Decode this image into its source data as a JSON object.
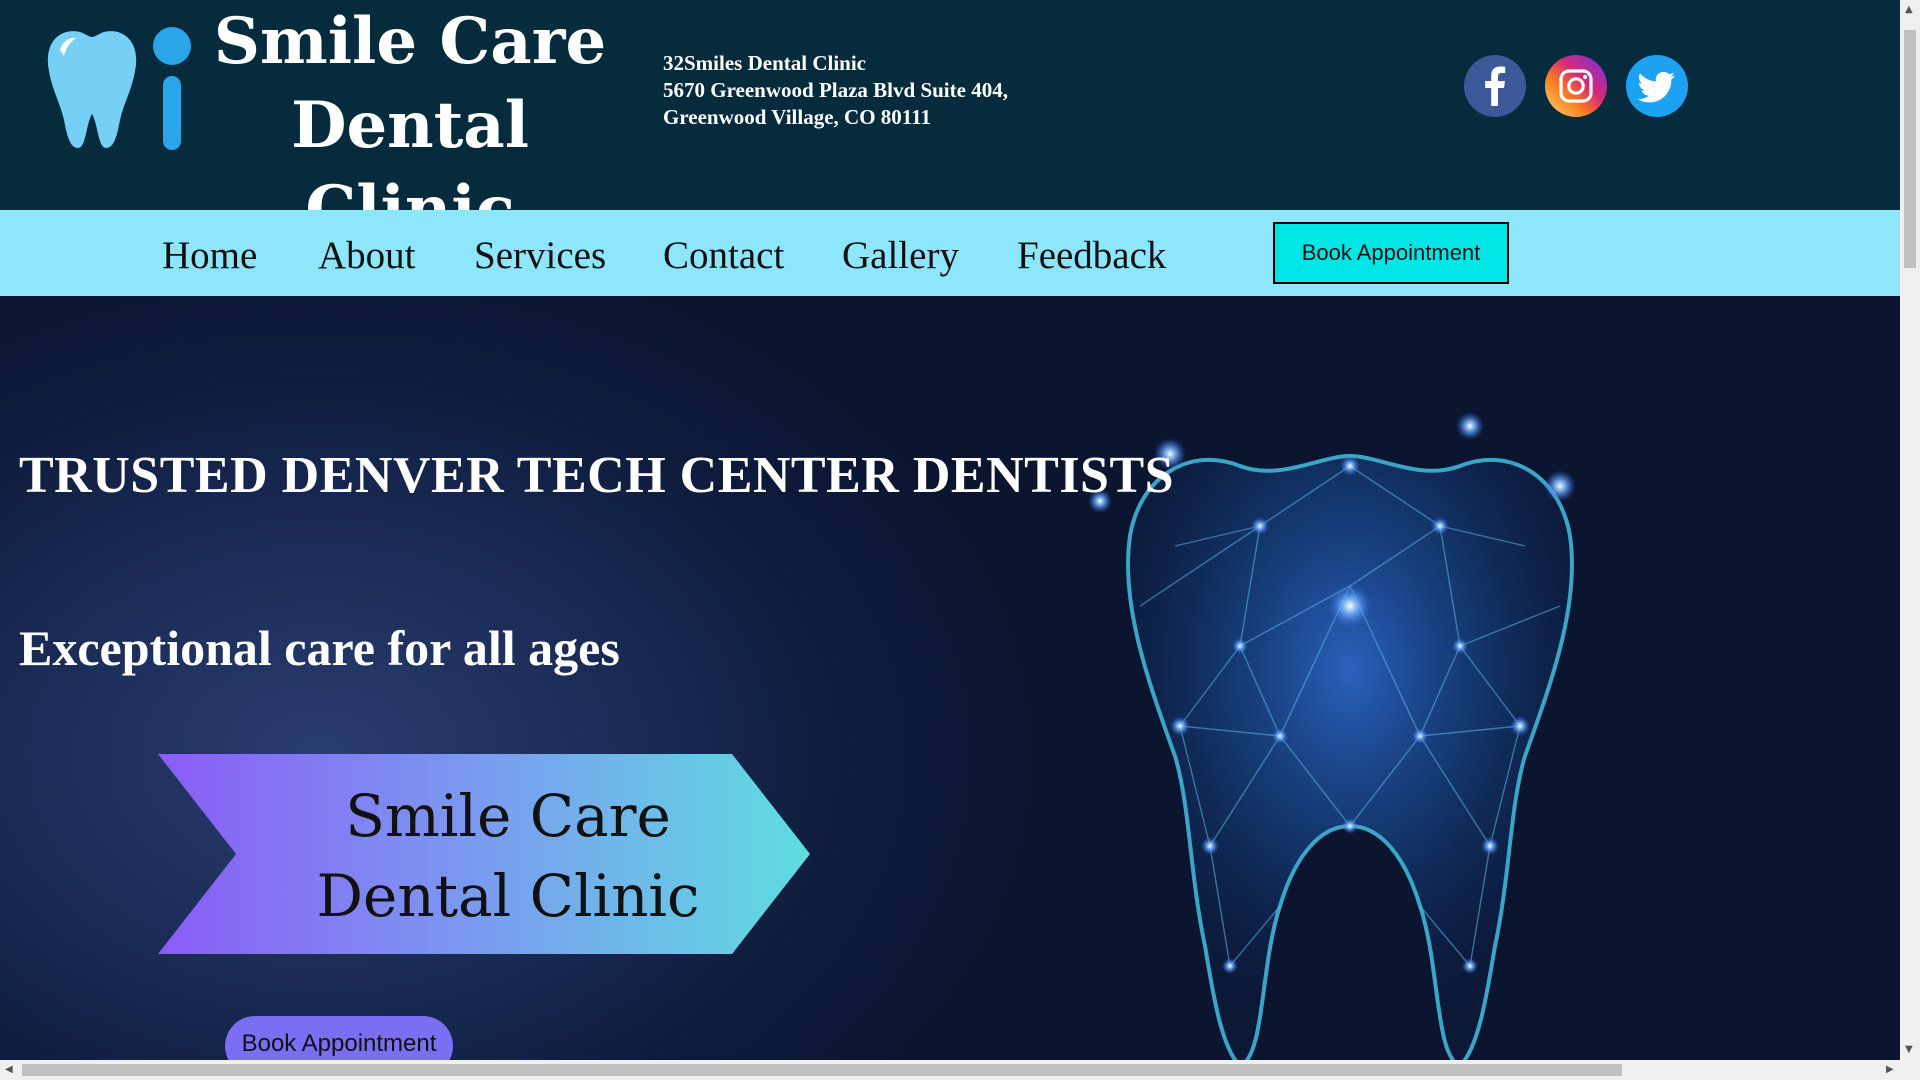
{
  "header": {
    "brand_line1": "Smile Care",
    "brand_line2": "Dental Clinic",
    "address_line1": "32Smiles Dental Clinic",
    "address_line2": "5670 Greenwood Plaza Blvd Suite 404,",
    "address_line3": "Greenwood Village, CO 80111",
    "social": [
      {
        "icon": "facebook-icon",
        "color": "#3b5998"
      },
      {
        "icon": "instagram-icon",
        "color": "#e1306c"
      },
      {
        "icon": "twitter-icon",
        "color": "#1da1f2"
      }
    ]
  },
  "nav": {
    "items": [
      "Home",
      "About",
      "Services",
      "Contact",
      "Gallery",
      "Feedback"
    ],
    "book_label": "Book Appointment",
    "background": "#8ee6fd",
    "book_color": "#00e5e6"
  },
  "hero": {
    "headline": "TRUSTED DENVER TECH CENTER DENTISTS",
    "subheadline": "Exceptional care for all ages",
    "banner_line1": "Smile Care",
    "banner_line2": "Dental Clinic",
    "book_label": "Book Appointment",
    "book_color": "#7a6ff2"
  },
  "colors": {
    "header_bg": "#052b3d",
    "hero_bg": "#0e1b3d"
  }
}
